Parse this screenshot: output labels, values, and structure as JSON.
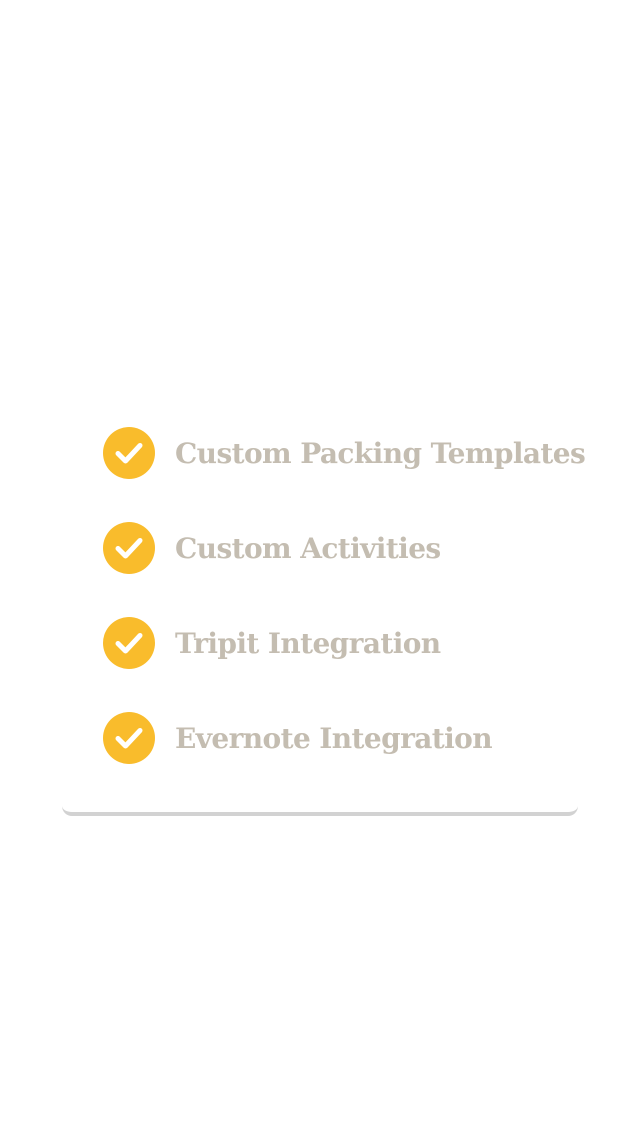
{
  "colors": {
    "accent": "#f9bc2c",
    "text": "#c4bdb1",
    "card_shadow": "#d2d2d2",
    "background": "#ffffff"
  },
  "features": [
    {
      "label": "Custom Packing Templates",
      "icon": "check-circle-icon"
    },
    {
      "label": "Custom Activities",
      "icon": "check-circle-icon"
    },
    {
      "label": "Tripit Integration",
      "icon": "check-circle-icon"
    },
    {
      "label": "Evernote Integration",
      "icon": "check-circle-icon"
    }
  ]
}
